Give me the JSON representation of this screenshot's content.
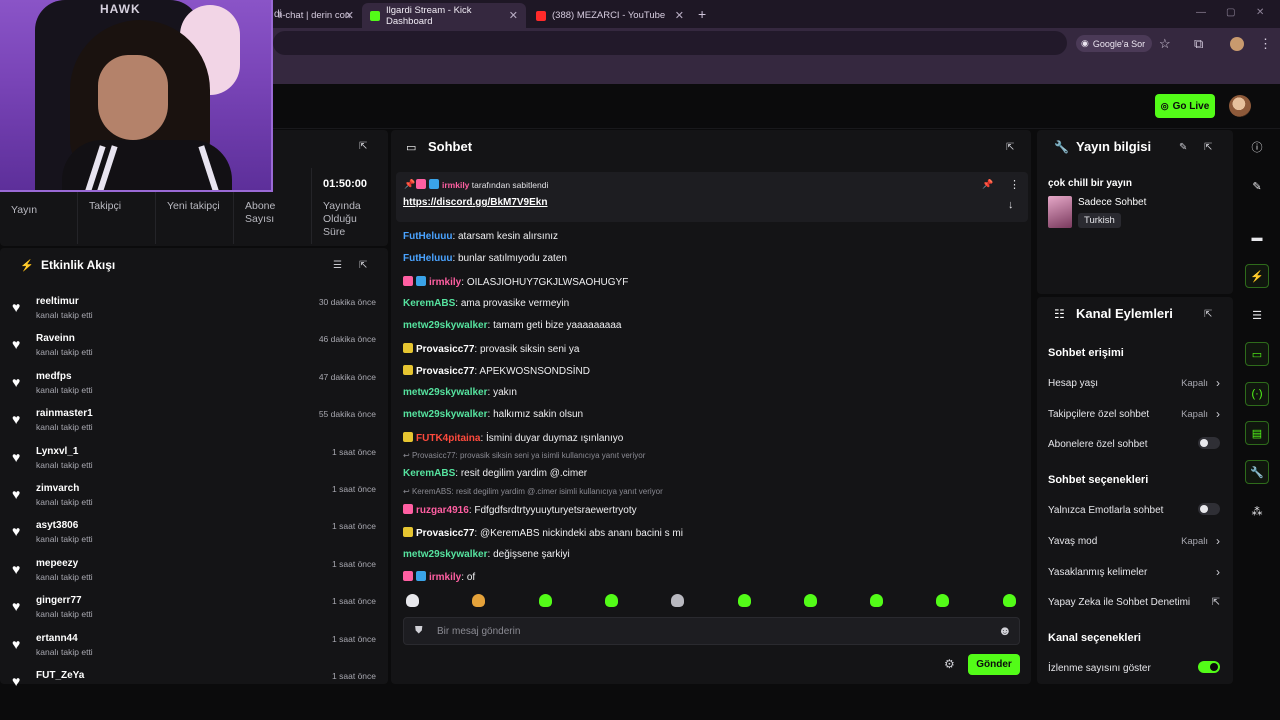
{
  "browser": {
    "tabs": [
      {
        "label": "li-chat | derin con",
        "fav": "#8f7ba4"
      },
      {
        "label": "Ilgardi Stream - Kick Dashboard",
        "fav": "#53fc18"
      },
      {
        "label": "(388) MEZARCI - YouTube",
        "fav": "#ff2a2a"
      }
    ],
    "url": "di",
    "google_chip": "Google'a Sor"
  },
  "header": {
    "go_live": "Go Live"
  },
  "stats": {
    "labels": [
      "Yayın",
      "Takipçi",
      "Yeni takipçi",
      "Abone Sayısı",
      "Yayında Olduğu Süre"
    ],
    "stream_time": "01:50:00"
  },
  "activity": {
    "title": "Etkinlik Akışı",
    "items": [
      {
        "name": "reeltimur",
        "sub": "kanalı takip etti",
        "time": "30 dakika önce"
      },
      {
        "name": "Raveinn",
        "sub": "kanalı takip etti",
        "time": "46 dakika önce"
      },
      {
        "name": "medfps",
        "sub": "kanalı takip etti",
        "time": "47 dakika önce"
      },
      {
        "name": "rainmaster1",
        "sub": "kanalı takip etti",
        "time": "55 dakika önce"
      },
      {
        "name": "Lynxvl_1",
        "sub": "kanalı takip etti",
        "time": "1 saat önce"
      },
      {
        "name": "zimvarch",
        "sub": "kanalı takip etti",
        "time": "1 saat önce"
      },
      {
        "name": "asyt3806",
        "sub": "kanalı takip etti",
        "time": "1 saat önce"
      },
      {
        "name": "mepeezy",
        "sub": "kanalı takip etti",
        "time": "1 saat önce"
      },
      {
        "name": "gingerr77",
        "sub": "kanalı takip etti",
        "time": "1 saat önce"
      },
      {
        "name": "ertann44",
        "sub": "kanalı takip etti",
        "time": "1 saat önce"
      },
      {
        "name": "FUT_ZeYa",
        "sub": "",
        "time": "1 saat önce"
      }
    ]
  },
  "chat": {
    "title": "Sohbet",
    "pinned_by_user": "irmkily",
    "pinned_suffix": "tarafından sabitlendi",
    "pinned_link": "https://discord.gg/BkM7V9Ekn",
    "messages": [
      {
        "user": "FutHeluuu",
        "color": "#4aa3ff",
        "text": "atarsam kesin alırsınız",
        "badges": []
      },
      {
        "user": "FutHeluuu",
        "color": "#4aa3ff",
        "text": "bunlar satılmıyodu zaten",
        "badges": []
      },
      {
        "user": "irmkily",
        "color": "#ff5fa2",
        "text": "OILASJIOHUY7GKJLWSAOHUGYF",
        "badges": [
          "#ff5fa2",
          "#3aa3e8"
        ]
      },
      {
        "user": "KeremABS",
        "color": "#56e39f",
        "text": "ama provasike vermeyin",
        "badges": []
      },
      {
        "user": "metw29skywalker",
        "color": "#56e39f",
        "text": "tamam geti bize yaaaaaaaaa",
        "badges": []
      },
      {
        "user": "Provasicc77",
        "color": "#ffffff",
        "text": "provasik siksin seni ya",
        "badges": [
          "#e6c531"
        ]
      },
      {
        "user": "Provasicc77",
        "color": "#ffffff",
        "text": "APEKWOSNSONDSİND",
        "badges": [
          "#e6c531"
        ]
      },
      {
        "user": "metw29skywalker",
        "color": "#56e39f",
        "text": "yakın",
        "badges": []
      },
      {
        "user": "metw29skywalker",
        "color": "#56e39f",
        "text": "halkımız sakin olsun",
        "badges": []
      },
      {
        "user": "FUTK4pitaina",
        "color": "#ff4a3d",
        "text": "İsmini duyar duymaz ışınlanıyo",
        "badges": [
          "#e6c531"
        ]
      },
      {
        "reply": "Provasicc77: provasik siksin seni ya isimli kullanıcıya yanıt veriyor"
      },
      {
        "user": "KeremABS",
        "color": "#56e39f",
        "text": "resit degilim yardim @.cimer",
        "badges": []
      },
      {
        "reply": "KeremABS: resit degilim yardim @.cimer isimli kullanıcıya yanıt veriyor"
      },
      {
        "user": "ruzgar4916",
        "color": "#ff5fa2",
        "text": "Fdfgdfsrdtrtyyuuyturyetsraewertryoty",
        "badges": [
          "#ff5fa2"
        ]
      },
      {
        "user": "Provasicc77",
        "color": "#ffffff",
        "text": "@KeremABS nickindeki abs ananı bacini s mi",
        "badges": [
          "#e6c531"
        ]
      },
      {
        "user": "metw29skywalker",
        "color": "#56e39f",
        "text": "değişsene şarkiyi",
        "badges": []
      },
      {
        "user": "irmkily",
        "color": "#ff5fa2",
        "text": "of",
        "badges": [
          "#ff5fa2",
          "#3aa3e8"
        ]
      }
    ],
    "input_placeholder": "Bir mesaj gönderin",
    "send_label": "Gönder"
  },
  "stream_info": {
    "title": "Yayın bilgisi",
    "stream_title": "çok chill bir yayın",
    "category": "Sadece Sohbet",
    "language": "Turkish"
  },
  "channel_actions": {
    "title": "Kanal Eylemleri",
    "sections": [
      {
        "heading": "Sohbet erişimi",
        "rows": [
          {
            "label": "Hesap yaşı",
            "value": "Kapalı",
            "control": "chevron"
          },
          {
            "label": "Takipçilere özel sohbet",
            "value": "Kapalı",
            "control": "chevron"
          },
          {
            "label": "Abonelere özel sohbet",
            "value": "",
            "control": "toggle-off"
          }
        ]
      },
      {
        "heading": "Sohbet seçenekleri",
        "rows": [
          {
            "label": "Yalnızca Emotlarla sohbet",
            "value": "",
            "control": "toggle-off"
          },
          {
            "label": "Yavaş mod",
            "value": "Kapalı",
            "control": "chevron"
          },
          {
            "label": "Yasaklanmış kelimeler",
            "value": "",
            "control": "chevron"
          },
          {
            "label": "Yapay Zeka ile Sohbet Denetimi",
            "value": "",
            "control": "external"
          }
        ]
      },
      {
        "heading": "Kanal seçenekleri",
        "rows": [
          {
            "label": "İzlenme sayısını göster",
            "value": "",
            "control": "toggle-on"
          }
        ]
      }
    ]
  },
  "webcam": {
    "logo": "HAWK"
  },
  "colors": {
    "accent": "#53fc18",
    "panel": "#141416",
    "background": "#0b0b0c"
  }
}
